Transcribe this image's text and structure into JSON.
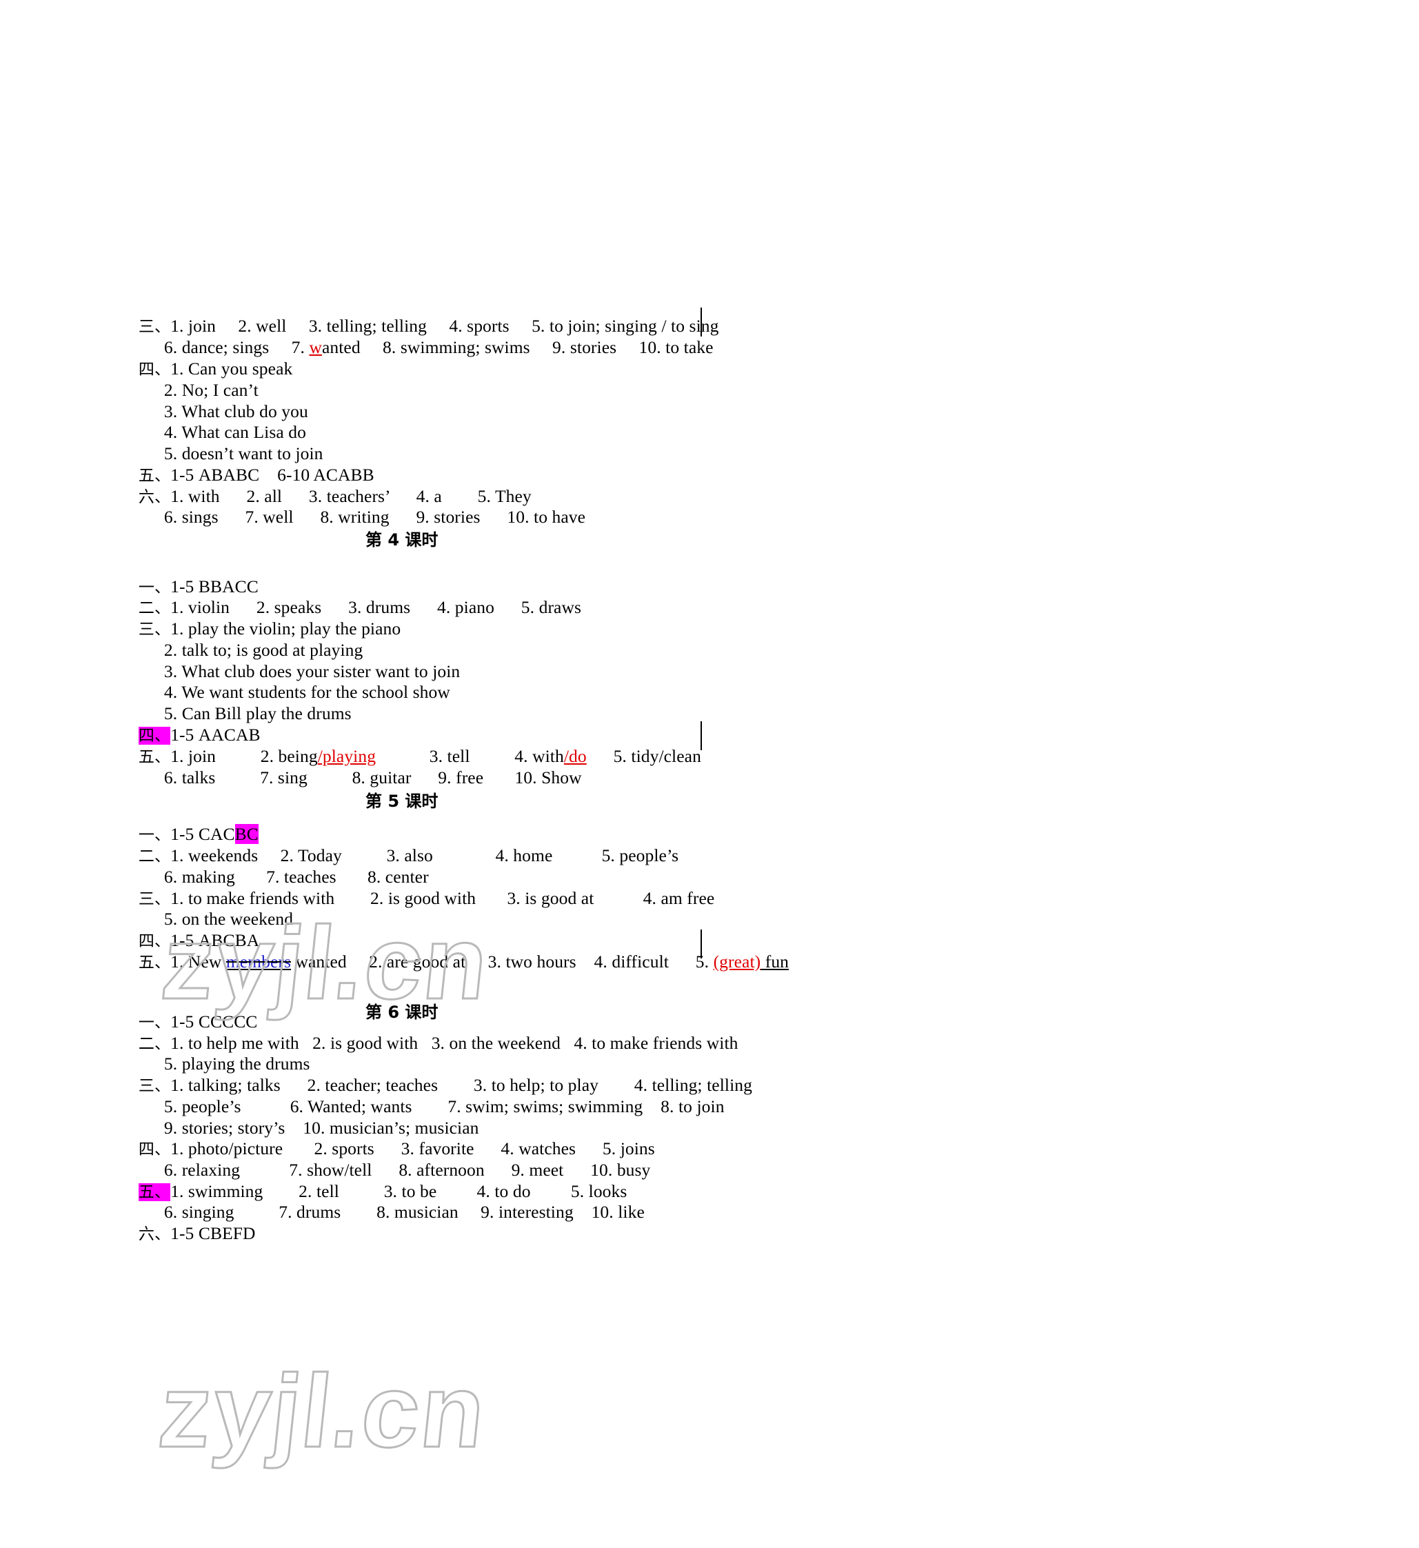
{
  "page": {
    "watermark_text": "zyjl.cn"
  },
  "lesson3_tail": {
    "blocks": [
      {
        "marker": "三、",
        "lines": [
          "1. join     2. well     3. telling; telling     4. sports     5. to join; singing / to sing",
          "6. dance; sings     7. wanted     8. swimming; swims     9. stories     10. to take"
        ]
      },
      {
        "marker": "四、",
        "lines": [
          "1. Can you speak",
          "2. No; I can’t",
          "3. What club do you",
          "4. What can Lisa do",
          "5. doesn’t want to join"
        ]
      },
      {
        "marker": "五、",
        "lines": [
          "1-5 ABABC    6-10 ACABB"
        ]
      },
      {
        "marker": "六、",
        "lines": [
          "1. with      2. all      3. teachers’      4. a        5. They",
          "6. sings      7. well      8. writing      9. stories      10. to have"
        ]
      }
    ]
  },
  "lesson4": {
    "title": "第 4 课时",
    "blocks": [
      {
        "marker": "一、",
        "lines": [
          "1-5 BBACC"
        ]
      },
      {
        "marker": "二、",
        "lines": [
          "1. violin      2. speaks      3. drums      4. piano      5. draws"
        ]
      },
      {
        "marker": "三、",
        "lines": [
          "1. play the violin; play the piano",
          "2. talk to; is good at playing",
          "3. What club does your sister want to join",
          "4. We want students for the school show",
          "5. Can Bill play the drums"
        ]
      },
      {
        "marker": "四、",
        "marker_highlight": true,
        "lines": [
          "1-5 AACAB"
        ]
      },
      {
        "marker": "五、",
        "lines": [
          "1. join          2. being/playing            3. tell          4. with/do      5. tidy/clean",
          "6. talks          7. sing          8. guitar      9. free       10. Show"
        ]
      }
    ]
  },
  "lesson5": {
    "title": "第 5 课时",
    "blocks": [
      {
        "marker": "一、",
        "lines": [
          "1-5 CACBC"
        ]
      },
      {
        "marker": "二、",
        "lines": [
          "1. weekends     2. Today          3. also              4. home           5. people’s",
          "6. making       7. teaches       8. center"
        ]
      },
      {
        "marker": "三、",
        "lines": [
          "1. to make friends with        2. is good with       3. is good at           4. am free",
          "5. on the weekend"
        ]
      },
      {
        "marker": "四、",
        "lines": [
          "1-5 ABCBA"
        ]
      },
      {
        "marker": "五、",
        "lines": [
          "1. New members wanted     2. are good at     3. two hours    4. difficult      5. (great) fun"
        ]
      }
    ]
  },
  "lesson6": {
    "title": "第 6 课时",
    "blocks": [
      {
        "marker": "一、",
        "lines": [
          "1-5 CCCCC"
        ]
      },
      {
        "marker": "二、",
        "lines": [
          "1. to help me with   2. is good with   3. on the weekend   4. to make friends with",
          "5. playing the drums"
        ]
      },
      {
        "marker": "三、",
        "lines": [
          "1. talking; talks      2. teacher; teaches        3. to help; to play        4. telling; telling",
          "5. people’s           6. Wanted; wants        7. swim; swims; swimming    8. to join",
          "9. stories; story’s    10. musician’s; musician"
        ]
      },
      {
        "marker": "四、",
        "lines": [
          "1. photo/picture       2. sports      3. favorite      4. watches      5. joins",
          "6. relaxing           7. show/tell      8. afternoon      9. meet      10. busy"
        ]
      },
      {
        "marker": "五、",
        "marker_highlight": true,
        "lines": [
          "1. swimming        2. tell          3. to be         4. to do         5. looks",
          "6. singing          7. drums        8. musician     9. interesting    10. like"
        ]
      },
      {
        "marker": "六、",
        "lines": [
          "1-5 CBEFD"
        ]
      }
    ]
  },
  "inline_marks": {
    "wanted_w": "w",
    "wanted_rest": "anted",
    "being": "2. being",
    "playing": "/playing",
    "with": "4. with",
    "do": "/do",
    "cacbc_head": "1-5 CAC",
    "cacbc_hl": "BC",
    "new": "1. New ",
    "members": "members",
    "wanted_word": " wanted",
    "great": "(great)",
    "fun": " fun"
  },
  "colors": {
    "highlight": "#ff00ff",
    "red": "#e00000",
    "blue": "#2222cc",
    "text": "#000000"
  }
}
